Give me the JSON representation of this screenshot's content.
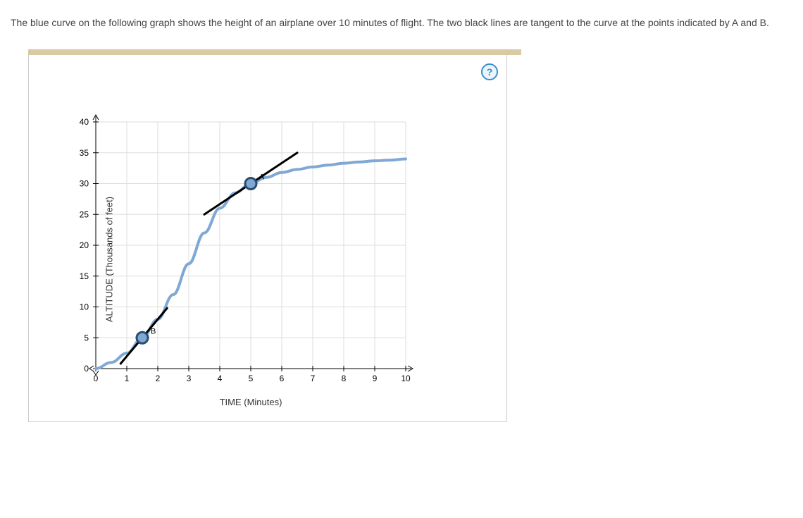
{
  "problem": {
    "text": "The blue curve on the following graph shows the height of an airplane over 10 minutes of flight. The two black lines are tangent to the curve at the points indicated by A and B."
  },
  "help": {
    "symbol": "?"
  },
  "chart_data": {
    "type": "line",
    "title": "",
    "xlabel": "TIME (Minutes)",
    "ylabel": "ALTITUDE (Thousands of feet)",
    "xlim": [
      0,
      10
    ],
    "ylim": [
      0,
      40
    ],
    "xticks": [
      0,
      1,
      2,
      3,
      4,
      5,
      6,
      7,
      8,
      9,
      10
    ],
    "yticks": [
      0,
      5,
      10,
      15,
      20,
      25,
      30,
      35,
      40
    ],
    "grid": true,
    "series": [
      {
        "name": "altitude_curve",
        "color": "#7fa8d4",
        "x": [
          0,
          0.5,
          1,
          1.5,
          2,
          2.5,
          3,
          3.5,
          4,
          4.5,
          5,
          5.5,
          6,
          6.5,
          7,
          7.5,
          8,
          8.5,
          9,
          9.5,
          10
        ],
        "y": [
          0,
          1,
          2.5,
          5,
          8,
          12,
          17,
          22,
          26,
          28.5,
          30,
          31,
          31.8,
          32.3,
          32.7,
          33,
          33.3,
          33.5,
          33.7,
          33.8,
          34
        ]
      }
    ],
    "annotations": [
      {
        "name": "A",
        "label": "A",
        "x": 5,
        "y": 30,
        "type": "point",
        "tangent_slope": 3.3,
        "tangent_segment": {
          "x1": 3.5,
          "y1": 25,
          "x2": 6.5,
          "y2": 35
        }
      },
      {
        "name": "B",
        "label": "B",
        "x": 1.5,
        "y": 5,
        "type": "point",
        "tangent_slope": 6,
        "tangent_segment": {
          "x1": 0.8,
          "y1": 0.8,
          "x2": 2.3,
          "y2": 9.8
        }
      }
    ]
  }
}
